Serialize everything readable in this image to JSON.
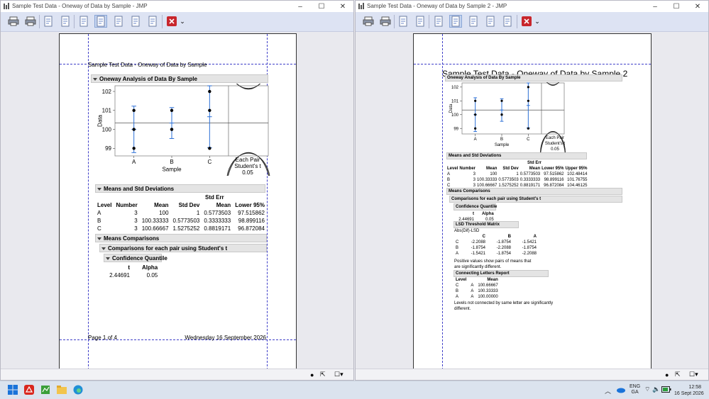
{
  "windows": {
    "left": {
      "title": "Sample Test Data - Oneway of Data by Sample - JMP"
    },
    "right": {
      "title": "Sample Test Data - Oneway of Data by Sample 2 - JMP"
    }
  },
  "window_controls": {
    "minimize": "–",
    "maximize": "☐",
    "close": "✕"
  },
  "toolbar_icons": [
    "print-icon",
    "print-setup-icon",
    "first-page-icon",
    "next-page-icon",
    "font-icon",
    "page-view-icon",
    "fit-page-icon",
    "page-up-icon",
    "page-down-icon",
    "close-red-icon"
  ],
  "left_page": {
    "header": "Sample Test Data - Oneway of Data by Sample",
    "oneway_title": "Oneway Analysis of Data By Sample",
    "y_ticks": [
      "102",
      "101",
      "100",
      "99"
    ],
    "ylabel": "Data",
    "x_categories": [
      "A",
      "B",
      "C"
    ],
    "xlabel": "Sample",
    "each_pair": [
      "Each Pair",
      "Student's t",
      "0.05"
    ],
    "means_title": "Means and Std Deviations",
    "means_headers": [
      "Level",
      "Number",
      "Mean",
      "Std Dev",
      "Std Err Mean",
      "Lower 95%"
    ],
    "std_err_line1": "Std Err",
    "std_err_line2": "Mean",
    "means_rows": [
      [
        "A",
        "3",
        "100",
        "1",
        "0.5773503",
        "97.515862"
      ],
      [
        "B",
        "3",
        "100.33333",
        "0.5773503",
        "0.3333333",
        "98.899116"
      ],
      [
        "C",
        "3",
        "100.66667",
        "1.5275252",
        "0.8819171",
        "96.872084"
      ]
    ],
    "comparisons_title": "Means Comparisons",
    "each_pair_title": "Comparisons for each pair using Student's t",
    "quantile_title": "Confidence Quantile",
    "quantile_headers": [
      "t",
      "Alpha"
    ],
    "quantile_values": [
      "2.44691",
      "0.05"
    ],
    "footer_left": "Page 1 of 4",
    "footer_right": "Wednesday 16 September 2026"
  },
  "right_page": {
    "header": "Sample Test Data - Oneway of Data by Sample 2",
    "oneway_title": "Oneway Analysis of Data By Sample",
    "y_ticks": [
      "102",
      "101",
      "100",
      "99"
    ],
    "ylabel": "Data",
    "x_categories": [
      "A",
      "B",
      "C"
    ],
    "xlabel": "Sample",
    "each_pair": [
      "Each Pair",
      "Student's t",
      "0.05"
    ],
    "means_title": "Means and Std Deviations",
    "std_err_line1": "Std Err",
    "std_err_line2": "Mean",
    "means_headers": [
      "Level",
      "Number",
      "Mean",
      "Std Dev",
      "Mean",
      "Lower 95%",
      "Upper 95%"
    ],
    "means_rows": [
      [
        "A",
        "3",
        "100",
        "1",
        "0.5773503",
        "97.515862",
        "102.48414"
      ],
      [
        "B",
        "3",
        "100.33333",
        "0.5773503",
        "0.3333333",
        "98.899116",
        "101.76755"
      ],
      [
        "C",
        "3",
        "100.66667",
        "1.5275252",
        "0.8819171",
        "96.872084",
        "104.46125"
      ]
    ],
    "comparisons_title": "Means Comparisons",
    "each_pair_title": "Comparisons for each pair using Student's t",
    "quantile_title": "Confidence Quantile",
    "quantile_headers": [
      "t",
      "Alpha"
    ],
    "quantile_values": [
      "2.44691",
      "0.05"
    ],
    "lsd_title": "LSD Threshold Matrix",
    "lsd_sub": "Abs(Dif)-LSD",
    "lsd_cols": [
      "C",
      "B",
      "A"
    ],
    "lsd_rows": [
      [
        "C",
        "-2.2088",
        "-1.8754",
        "-1.5421"
      ],
      [
        "B",
        "-1.8754",
        "-2.2088",
        "-1.8754"
      ],
      [
        "A",
        "-1.5421",
        "-1.8754",
        "-2.2088"
      ]
    ],
    "positive_note_1": "Positive values show pairs of means that",
    "positive_note_2": "are significantly different.",
    "connecting_title": "Connecting Letters Report",
    "connecting_headers": [
      "Level",
      "Mean"
    ],
    "connecting_rows": [
      [
        "C",
        "A",
        "100.66667"
      ],
      [
        "B",
        "A",
        "100.33333"
      ],
      [
        "A",
        "A",
        "100.00000"
      ]
    ],
    "levels_note_1": "Levels not connected by same letter are significantly",
    "levels_note_2": "different."
  },
  "status_icons": [
    "info-icon",
    "zoom-icon",
    "page-size-dropdown"
  ],
  "taskbar": {
    "apps": [
      "start-icon",
      "acrobat-icon",
      "jmp-icon",
      "file-explorer-icon",
      "edge-icon"
    ],
    "lang_line1": "ENG",
    "lang_line2": "GA",
    "time": "12:58",
    "date": "16 Sept 2026"
  },
  "chart_data": [
    {
      "type": "scatter",
      "xlabel": "Sample",
      "ylabel": "Data",
      "categories": [
        "A",
        "B",
        "C"
      ],
      "ylim": [
        98.6,
        102.3
      ],
      "points": {
        "A": [
          101,
          100,
          99
        ],
        "B": [
          101,
          100,
          100
        ],
        "C": [
          102,
          101,
          99
        ]
      },
      "means": [
        100,
        100.33333,
        100.66667
      ],
      "ci_lower": [
        98.775,
        99.517,
        99.037
      ],
      "ci_upper": [
        101.225,
        101.149,
        102.297
      ],
      "grand_mean": 100.33333
    }
  ]
}
